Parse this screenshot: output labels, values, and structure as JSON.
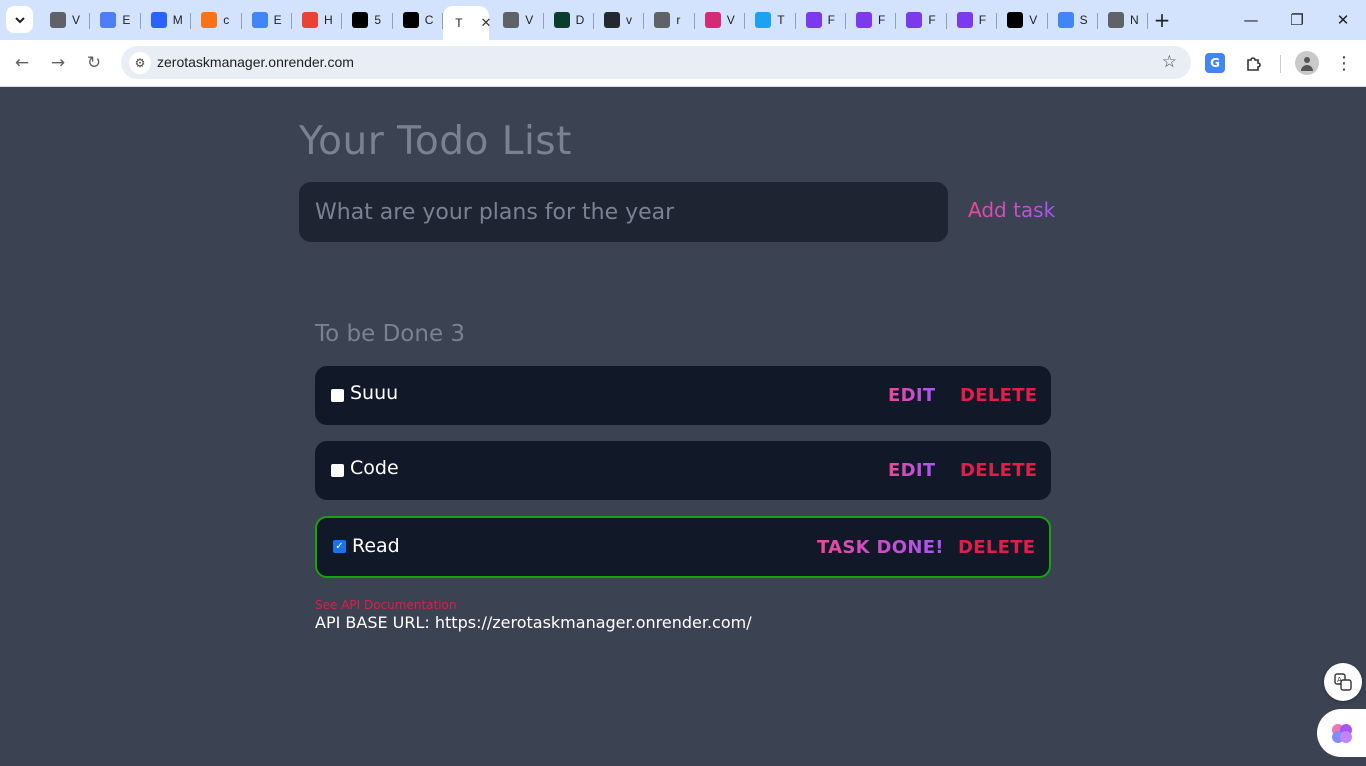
{
  "browser": {
    "tabs": [
      {
        "icon": "globe-icon",
        "initial": "V",
        "color": "#5f6368"
      },
      {
        "icon": "cloud-icon",
        "initial": "E",
        "color": "#4f7df5"
      },
      {
        "icon": "grid-icon",
        "initial": "M",
        "color": "#2962ff"
      },
      {
        "icon": "link-icon",
        "initial": "c",
        "color": "#f97316"
      },
      {
        "icon": "docs-icon",
        "initial": "E",
        "color": "#4285f4"
      },
      {
        "icon": "google-icon",
        "initial": "H",
        "color": "#ea4335"
      },
      {
        "icon": "puzzle-icon",
        "initial": "5",
        "color": "#000000"
      },
      {
        "icon": "puzzle-icon",
        "initial": "C",
        "color": "#000000"
      },
      {
        "icon": "globe-icon",
        "initial": "V",
        "color": "#5f6368"
      },
      {
        "icon": "leaf-icon",
        "initial": "D",
        "color": "#0b3d2e"
      },
      {
        "icon": "github-icon",
        "initial": "v",
        "color": "#24292f"
      },
      {
        "icon": "chat-icon",
        "initial": "r",
        "color": "#5f6368"
      },
      {
        "icon": "instagram-icon",
        "initial": "V",
        "color": "#d62976"
      },
      {
        "icon": "circle-c-icon",
        "initial": "T",
        "color": "#1da1f2"
      },
      {
        "icon": "chat-heart-icon",
        "initial": "F",
        "color": "#7c3aed"
      },
      {
        "icon": "chat-heart-icon",
        "initial": "F",
        "color": "#7c3aed"
      },
      {
        "icon": "chat-heart-icon",
        "initial": "F",
        "color": "#7c3aed"
      },
      {
        "icon": "chat-heart-icon",
        "initial": "F",
        "color": "#7c3aed"
      },
      {
        "icon": "home-icon",
        "initial": "V",
        "color": "#000000"
      },
      {
        "icon": "blue-dot-icon",
        "initial": "S",
        "color": "#4285f4"
      },
      {
        "icon": "globe-icon",
        "initial": "N",
        "color": "#5f6368"
      }
    ],
    "active_tab": {
      "initial": "T",
      "close": "✕"
    },
    "url": "zerotaskmanager.onrender.com"
  },
  "page": {
    "title": "Your Todo List",
    "input_placeholder": "What are your plans for the year",
    "add_task_label": "Add task",
    "section_label": "To be Done 3",
    "tasks": [
      {
        "name": "Suuu",
        "done": false,
        "primary_action": "EDIT",
        "delete_label": "DELETE"
      },
      {
        "name": "Code",
        "done": false,
        "primary_action": "EDIT",
        "delete_label": "DELETE"
      },
      {
        "name": "Read",
        "done": true,
        "primary_action": "TASK DONE!",
        "delete_label": "DELETE"
      }
    ],
    "api_link_text": "See API Documentation",
    "api_base_text": "API BASE URL: https://zerotaskmanager.onrender.com/"
  },
  "colors": {
    "page_bg": "#3b4252",
    "card_bg": "#111827",
    "input_bg": "#1f2433",
    "accent_gradient": [
      "#ec4899",
      "#a855f7"
    ],
    "delete": "#e11d48",
    "done_border": "#15a30f"
  }
}
